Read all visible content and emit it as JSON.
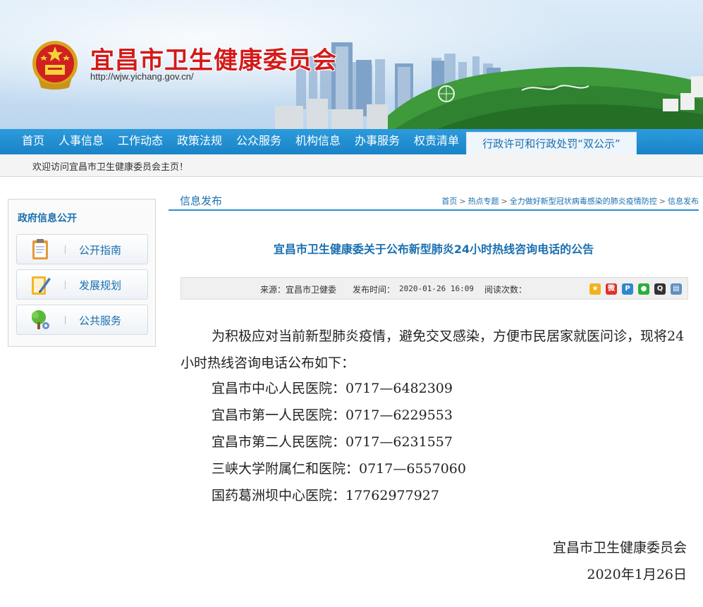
{
  "header": {
    "site_title": "宜昌市卫生健康委员会",
    "site_url": "http://wjw.yichang.gov.cn/"
  },
  "nav": {
    "items": [
      {
        "label": "首页"
      },
      {
        "label": "人事信息"
      },
      {
        "label": "工作动态"
      },
      {
        "label": "政策法规"
      },
      {
        "label": "公众服务"
      },
      {
        "label": "机构信息"
      },
      {
        "label": "办事服务"
      },
      {
        "label": "权责清单"
      }
    ],
    "special_tab": "行政许可和行政处罚“双公示”"
  },
  "welcome": "欢迎访问宜昌市卫生健康委员会主页！",
  "sidebar": {
    "title": "政府信息公开",
    "buttons": [
      {
        "label": "公开指南",
        "icon": "clipboard-icon"
      },
      {
        "label": "发展规划",
        "icon": "notebook-pen-icon"
      },
      {
        "label": "公共服务",
        "icon": "tree-icon"
      }
    ]
  },
  "section": {
    "title": "信息发布",
    "breadcrumb": [
      "首页",
      "热点专题",
      "全力做好新型冠状病毒感染的肺炎疫情防控",
      "信息发布"
    ],
    "breadcrumb_separator": ">"
  },
  "article": {
    "title": "宜昌市卫生健康委关于公布新型肺炎24小时热线咨询电话的公告",
    "source_label": "来源：宜昌市卫健委",
    "date_label": "发布时间：",
    "date_value": "2020-01-26 16:09",
    "views_label": "阅读次数：",
    "share_icons": [
      "qzone-icon",
      "weibo-icon",
      "tencent-weibo-icon",
      "wechat-icon",
      "qq-icon",
      "print-icon"
    ],
    "intro": "为积极应对当前新型肺炎疫情，避免交叉感染，方便市民居家就医问诊，现将24小时热线咨询电话公布如下：",
    "hotlines": [
      "宜昌市中心人民医院：0717—6482309",
      "宜昌市第一人民医院：0717—6229553",
      "宜昌市第二人民医院：0717—6231557",
      "三峡大学附属仁和医院：0717—6557060",
      "国药葛洲坝中心医院：17762977927"
    ],
    "signature": "宜昌市卫生健康委员会",
    "sign_date": "2020年1月26日"
  },
  "colors": {
    "nav_blue": "#1a83c7",
    "title_red": "#d41a1a",
    "link_blue": "#1a6fb0"
  }
}
